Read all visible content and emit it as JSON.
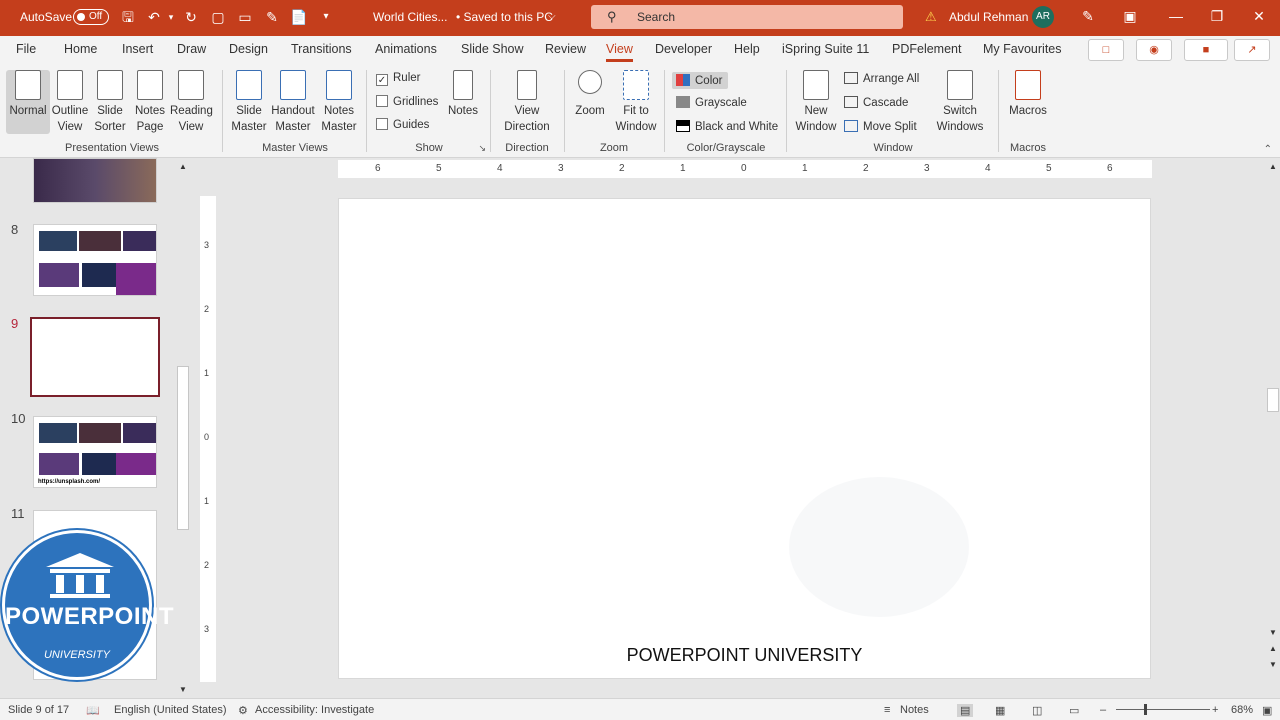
{
  "title_bar": {
    "autosave_label": "AutoSave",
    "autosave_state": "Off",
    "doc_title": "World Cities...",
    "save_status": "• Saved to this PC",
    "search_placeholder": "Search",
    "user_name": "Abdul Rehman",
    "user_initials": "AR"
  },
  "menu": {
    "tabs": [
      "File",
      "Home",
      "Insert",
      "Draw",
      "Design",
      "Transitions",
      "Animations",
      "Slide Show",
      "Review",
      "View",
      "Developer",
      "Help",
      "iSpring Suite 11",
      "PDFelement",
      "My Favourites"
    ],
    "active_tab": "View"
  },
  "ribbon": {
    "presentation_views": {
      "label": "Presentation Views",
      "buttons": [
        "Normal",
        "Outline\nView",
        "Slide\nSorter",
        "Notes\nPage",
        "Reading\nView"
      ]
    },
    "master_views": {
      "label": "Master Views",
      "buttons": [
        "Slide\nMaster",
        "Handout\nMaster",
        "Notes\nMaster"
      ]
    },
    "show": {
      "label": "Show",
      "ruler": "Ruler",
      "ruler_checked": true,
      "gridlines": "Gridlines",
      "gridlines_checked": false,
      "guides": "Guides",
      "guides_checked": false,
      "notes": "Notes"
    },
    "direction": {
      "label": "Direction",
      "button": "View\nDirection"
    },
    "zoom": {
      "label": "Zoom",
      "zoom": "Zoom",
      "fit": "Fit to\nWindow"
    },
    "color": {
      "label": "Color/Grayscale",
      "color": "Color",
      "grayscale": "Grayscale",
      "bw": "Black and White"
    },
    "window": {
      "label": "Window",
      "new_window": "New\nWindow",
      "arrange_all": "Arrange All",
      "cascade": "Cascade",
      "move_split": "Move Split",
      "switch": "Switch\nWindows"
    },
    "macros": {
      "label": "Macros",
      "button": "Macros"
    }
  },
  "thumbnails": {
    "numbers": [
      "8",
      "9",
      "10",
      "11"
    ],
    "selected": "9",
    "link_text": "https://unsplash.com/"
  },
  "ruler": {
    "top_ticks": [
      "6",
      "5",
      "4",
      "3",
      "2",
      "1",
      "0",
      "1",
      "2",
      "3",
      "4",
      "5",
      "6"
    ],
    "left_ticks": [
      "3",
      "2",
      "1",
      "0",
      "1",
      "2",
      "3"
    ]
  },
  "slide": {
    "caption": "POWERPOINT UNIVERSITY"
  },
  "logo": {
    "word": "POWERPOINT",
    "sub": "UNIVERSITY"
  },
  "status": {
    "slide_info": "Slide 9 of 17",
    "language": "English (United States)",
    "accessibility": "Accessibility: Investigate",
    "notes": "Notes",
    "zoom": "68%"
  },
  "colors": {
    "accent": "#c43e1c",
    "selection": "#7a1f2a",
    "logo_blue": "#2d73bd"
  }
}
